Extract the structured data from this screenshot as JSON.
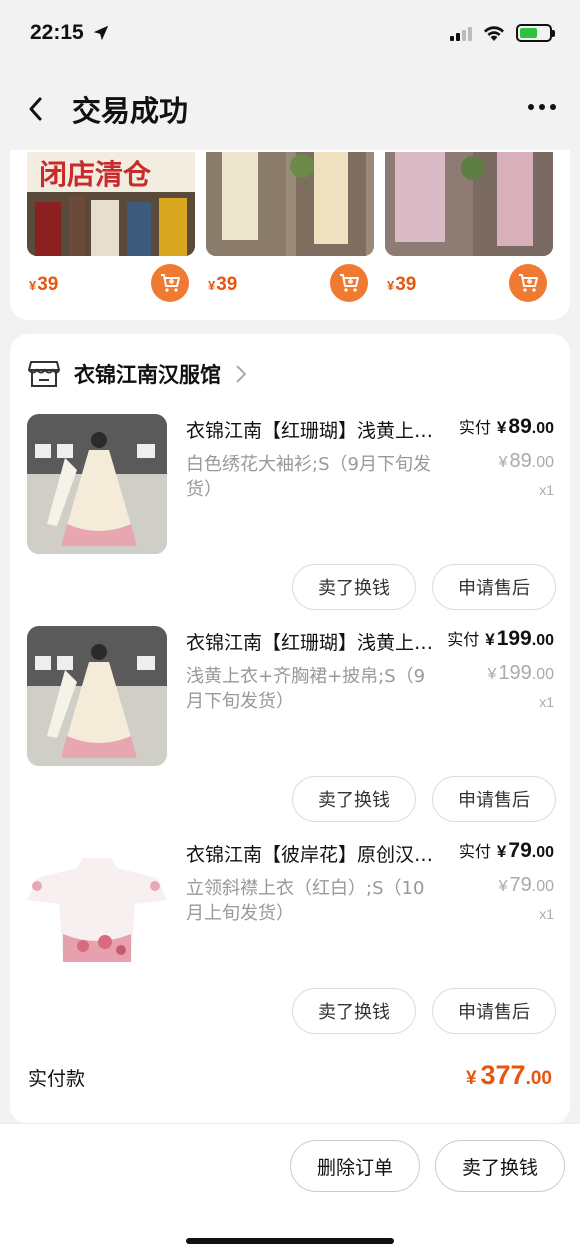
{
  "status_bar": {
    "time": "22:15"
  },
  "nav": {
    "title": "交易成功"
  },
  "recommendations": [
    {
      "price_symbol": "¥",
      "price": "39",
      "banner_text": "闭店清仓"
    },
    {
      "price_symbol": "¥",
      "price": "39"
    },
    {
      "price_symbol": "¥",
      "price": "39"
    }
  ],
  "shop": {
    "name": "衣锦江南汉服馆"
  },
  "items": [
    {
      "title": "衣锦江南【红珊瑚】浅黄上衣+齐胸裙+披帛",
      "spec": "白色绣花大袖衫;S（9月下旬发货）",
      "paid_label": "实付",
      "paid_symbol": "¥",
      "paid_int": "89",
      "paid_dec": ".00",
      "orig_symbol": "¥",
      "orig_int": "89",
      "orig_dec": ".00",
      "qty": "x1",
      "btn_sell": "卖了换钱",
      "btn_after_sale": "申请售后"
    },
    {
      "title": "衣锦江南【红珊瑚】浅黄上衣+齐胸裙+披帛",
      "spec": "浅黄上衣+齐胸裙+披帛;S（9月下旬发货）",
      "paid_label": "实付",
      "paid_symbol": "¥",
      "paid_int": "199",
      "paid_dec": ".00",
      "orig_symbol": "¥",
      "orig_int": "199",
      "orig_dec": ".00",
      "qty": "x1",
      "btn_sell": "卖了换钱",
      "btn_after_sale": "申请售后"
    },
    {
      "title": "衣锦江南【彼岸花】原创汉服立领斜襟上衣",
      "spec": "立领斜襟上衣（红白）;S（10月上旬发货）",
      "paid_label": "实付",
      "paid_symbol": "¥",
      "paid_int": "79",
      "paid_dec": ".00",
      "orig_symbol": "¥",
      "orig_int": "79",
      "orig_dec": ".00",
      "qty": "x1",
      "btn_sell": "卖了换钱",
      "btn_after_sale": "申请售后"
    }
  ],
  "total": {
    "label": "实付款",
    "symbol": "¥",
    "int": "377",
    "dec": ".00"
  },
  "bottom_bar": {
    "delete_order": "删除订单",
    "sell": "卖了换钱"
  },
  "colors": {
    "accent_orange": "#e8560d",
    "cart_button": "#f07a31",
    "battery_green": "#30c23f"
  },
  "icons": [
    "location-arrow-icon",
    "signal-icon",
    "wifi-icon",
    "battery-icon",
    "back-chevron-icon",
    "more-dots-icon",
    "cart-add-icon",
    "shop-icon",
    "chevron-right-icon"
  ]
}
